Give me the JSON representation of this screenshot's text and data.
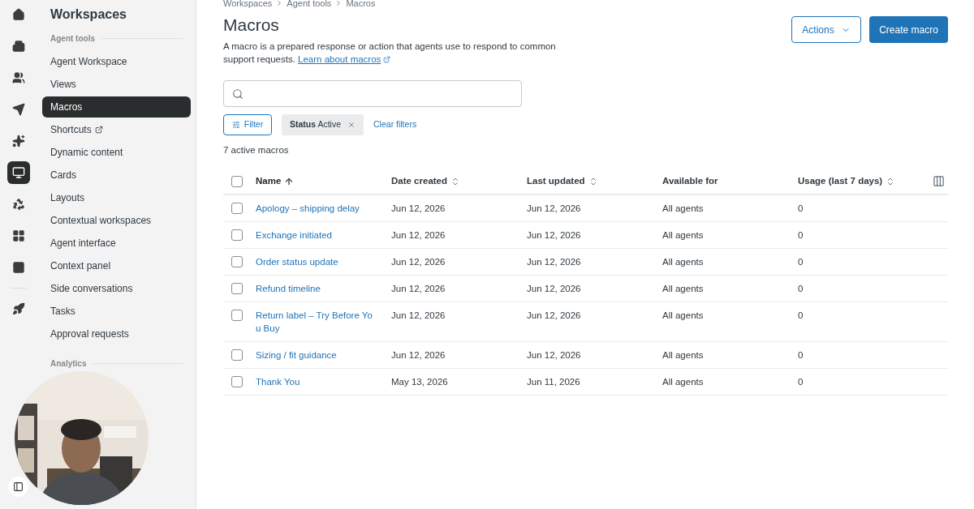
{
  "rail": [
    {
      "selected": false
    },
    {
      "selected": false
    },
    {
      "selected": false
    },
    {
      "selected": false
    },
    {
      "selected": false
    },
    {
      "selected": true
    },
    {
      "selected": false
    },
    {
      "selected": false
    },
    {
      "selected": false
    },
    {
      "selected": false
    }
  ],
  "sidebar": {
    "title": "Workspaces",
    "sections": [
      {
        "heading": "Agent tools",
        "items": [
          {
            "label": "Agent Workspace",
            "selected": false,
            "external": false
          },
          {
            "label": "Views",
            "selected": false,
            "external": false
          },
          {
            "label": "Macros",
            "selected": true,
            "external": false
          },
          {
            "label": "Shortcuts",
            "selected": false,
            "external": true
          },
          {
            "label": "Dynamic content",
            "selected": false,
            "external": false
          },
          {
            "label": "Cards",
            "selected": false,
            "external": false
          },
          {
            "label": "Layouts",
            "selected": false,
            "external": false
          },
          {
            "label": "Contextual workspaces",
            "selected": false,
            "external": false
          },
          {
            "label": "Agent interface",
            "selected": false,
            "external": false
          },
          {
            "label": "Context panel",
            "selected": false,
            "external": false
          },
          {
            "label": "Side conversations",
            "selected": false,
            "external": false
          },
          {
            "label": "Tasks",
            "selected": false,
            "external": false
          },
          {
            "label": "Approval requests",
            "selected": false,
            "external": false
          }
        ]
      },
      {
        "heading": "Analytics"
      }
    ]
  },
  "breadcrumbs": [
    "Workspaces",
    "Agent tools",
    "Macros"
  ],
  "title": "Macros",
  "description": "A macro is a prepared response or action that agents use to respond to common support requests.",
  "learn_link": "Learn about macros",
  "actions_button": "Actions",
  "create_button": "Create macro",
  "filter_button": "Filter",
  "filter_chip": {
    "key": "Status",
    "value": "Active"
  },
  "clear_filters": "Clear filters",
  "count": "7 active macros",
  "table": {
    "columns": [
      {
        "label": "Name",
        "sortable": true,
        "sorted": true
      },
      {
        "label": "Date created",
        "sortable": true,
        "sorted": false
      },
      {
        "label": "Last updated",
        "sortable": true,
        "sorted": false
      },
      {
        "label": "Available for",
        "sortable": false
      },
      {
        "label": "Usage (last 7 days)",
        "sortable": true,
        "sorted": false
      }
    ],
    "select_all": {
      "checked": false
    },
    "rows": [
      {
        "checked": false,
        "cells": [
          "Apology – shipping delay",
          "Jun 12, 2026",
          "Jun 12, 2026",
          "All agents",
          "0"
        ]
      },
      {
        "checked": false,
        "cells": [
          "Exchange initiated",
          "Jun 12, 2026",
          "Jun 12, 2026",
          "All agents",
          "0"
        ]
      },
      {
        "checked": false,
        "cells": [
          "Order status update",
          "Jun 12, 2026",
          "Jun 12, 2026",
          "All agents",
          "0"
        ]
      },
      {
        "checked": false,
        "cells": [
          "Refund timeline",
          "Jun 12, 2026",
          "Jun 12, 2026",
          "All agents",
          "0"
        ]
      },
      {
        "checked": false,
        "cells": [
          "Return label – Try Before You Buy",
          "Jun 12, 2026",
          "Jun 12, 2026",
          "All agents",
          "0"
        ]
      },
      {
        "checked": false,
        "cells": [
          "Sizing / fit guidance",
          "Jun 12, 2026",
          "Jun 12, 2026",
          "All agents",
          "0"
        ]
      },
      {
        "checked": false,
        "cells": [
          "Thank You",
          "May 13, 2026",
          "Jun 11, 2026",
          "All agents",
          "0"
        ]
      }
    ]
  }
}
